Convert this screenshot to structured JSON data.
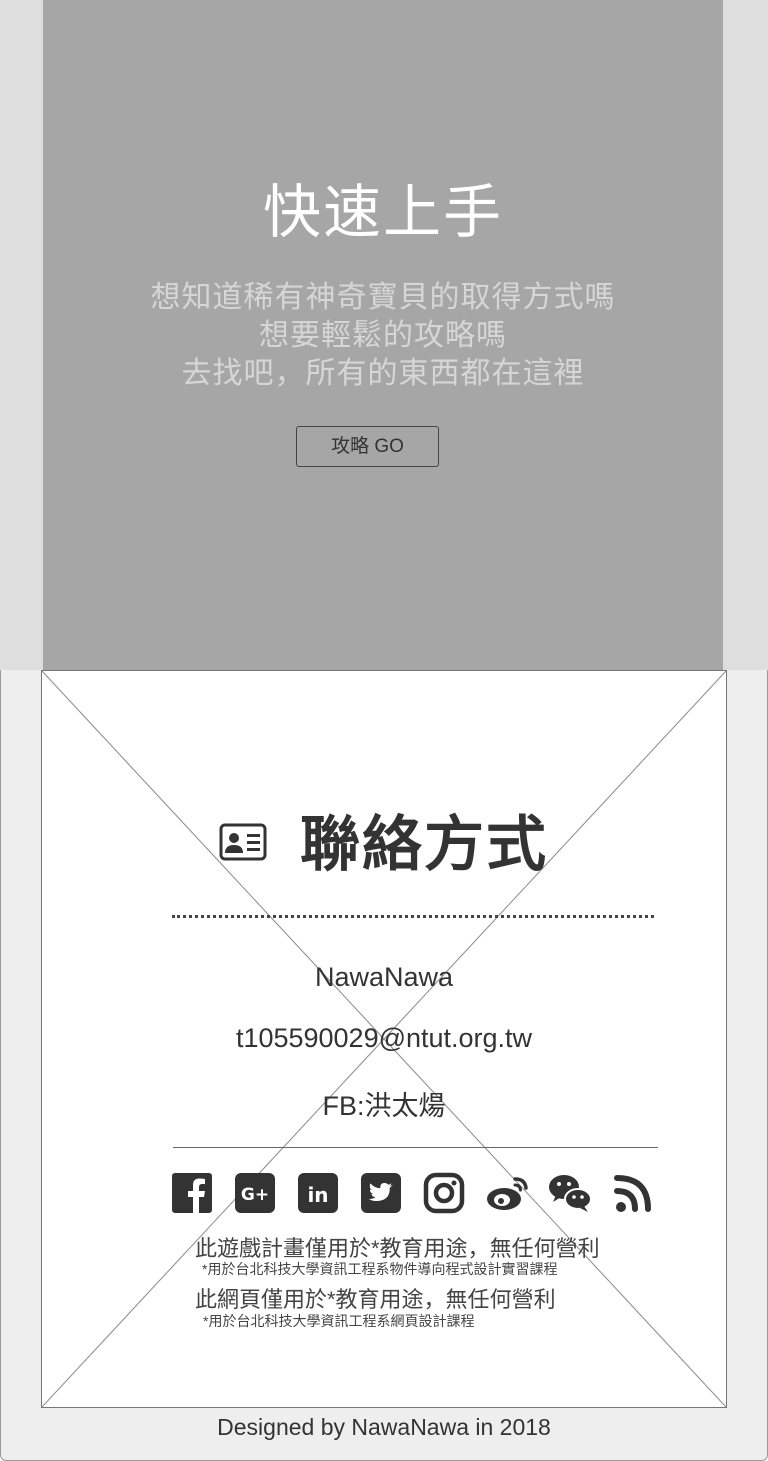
{
  "hero": {
    "title": "快速上手",
    "lines": [
      "想知道稀有神奇寶貝的取得方式嗎",
      "想要輕鬆的攻略嗎",
      "去找吧，所有的東西都在這裡"
    ],
    "button_label": "攻略 GO"
  },
  "contact": {
    "icon": "id-card-icon",
    "title": "聯絡方式",
    "name": "NawaNawa",
    "email": "t105590029@ntut.org.tw",
    "fb": "FB:洪太煬"
  },
  "social": {
    "icons": [
      "facebook-icon",
      "google-plus-icon",
      "linkedin-icon",
      "twitter-icon",
      "instagram-icon",
      "weibo-icon",
      "wechat-icon",
      "rss-icon"
    ]
  },
  "notes": {
    "game": "此遊戲計畫僅用於*教育用途，無任何營利",
    "game_sub": "*用於台北科技大學資訊工程系物件導向程式設計實習課程",
    "web": "此網頁僅用於*教育用途，無任何營利",
    "web_sub": "*用於台北科技大學資訊工程系網頁設計課程"
  },
  "footer": {
    "designed_by": "Designed by NawaNawa in 2018"
  },
  "colors": {
    "hero_bg": "#a6a6a6",
    "hero_side": "#dedede",
    "hero_title": "#ffffff",
    "hero_text": "#d6d6d6",
    "text": "#333333"
  }
}
